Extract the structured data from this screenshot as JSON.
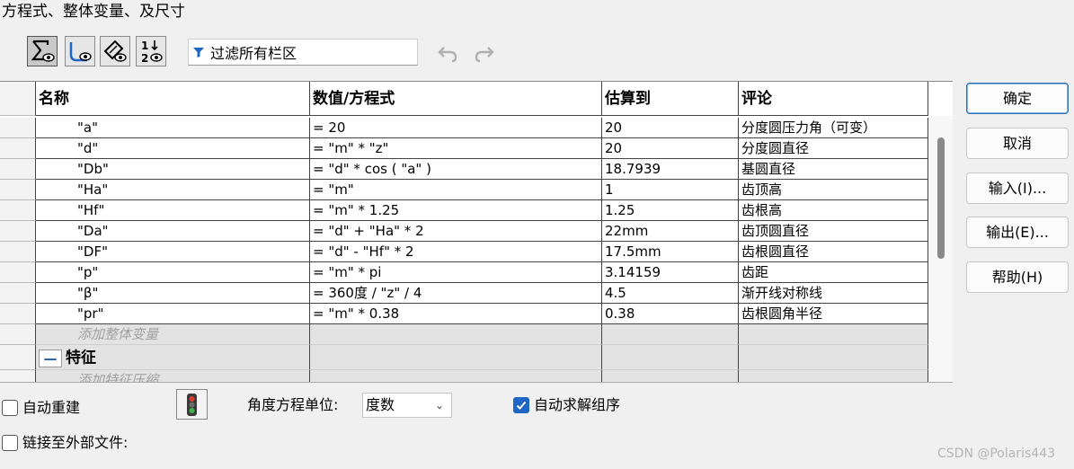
{
  "window": {
    "title": "方程式、整体变量、及尺寸"
  },
  "toolbar": {
    "buttons": [
      {
        "icon": "sigma-eye-icon",
        "active": true
      },
      {
        "icon": "sketch-eye-icon",
        "active": false
      },
      {
        "icon": "dimension-eye-icon",
        "active": false
      },
      {
        "icon": "order-eye-icon",
        "active": false
      }
    ],
    "filter": {
      "icon": "filter-icon",
      "placeholder": "过滤所有栏区"
    },
    "undo_icon": "undo-icon",
    "redo_icon": "redo-icon"
  },
  "table": {
    "headers": [
      "名称",
      "数值/方程式",
      "估算到",
      "评论"
    ],
    "rows": [
      {
        "name": "\"a\"",
        "value": "= 20",
        "eval": "20",
        "comment": "分度圆压力角（可变）"
      },
      {
        "name": "\"d\"",
        "value": "= \"m\" * \"z\"",
        "eval": "20",
        "comment": "分度圆直径"
      },
      {
        "name": "\"Db\"",
        "value": "= \"d\" * cos ( \"a\" )",
        "eval": "18.7939",
        "comment": "基圆直径"
      },
      {
        "name": "\"Ha\"",
        "value": "= \"m\"",
        "eval": "1",
        "comment": "齿顶高"
      },
      {
        "name": "\"Hf\"",
        "value": "= \"m\" * 1.25",
        "eval": "1.25",
        "comment": "齿根高"
      },
      {
        "name": "\"Da\"",
        "value": "= \"d\" + \"Ha\" * 2",
        "eval": "22mm",
        "comment": "齿顶圆直径"
      },
      {
        "name": "\"DF\"",
        "value": "= \"d\" - \"Hf\" * 2",
        "eval": "17.5mm",
        "comment": "齿根圆直径"
      },
      {
        "name": "\"p\"",
        "value": "= \"m\" * pi",
        "eval": "3.14159",
        "comment": "齿距"
      },
      {
        "name": "\"β\"",
        "value": "= 360度 / \"z\" / 4",
        "eval": "4.5",
        "comment": "渐开线对称线"
      },
      {
        "name": "\"pr\"",
        "value": "= \"m\" * 0.38",
        "eval": "0.38",
        "comment": "齿根圆角半径"
      }
    ],
    "add_global_placeholder": "添加整体变量",
    "section_features": {
      "collapse_symbol": "—",
      "label": "特征"
    },
    "add_feature_placeholder": "添加特征压缩"
  },
  "side_buttons": {
    "ok": "确定",
    "cancel": "取消",
    "import": "输入(I)...",
    "export": "输出(E)...",
    "help": "帮助(H)"
  },
  "bottom": {
    "auto_rebuild": {
      "label": "自动重建",
      "checked": false
    },
    "traffic_light_icon": "traffic-light-icon",
    "angle_unit": {
      "label": "角度方程单位:",
      "value": "度数"
    },
    "auto_solve_order": {
      "label": "自动求解组序",
      "checked": true
    },
    "link_external": {
      "label": "链接至外部文件:",
      "checked": false
    }
  },
  "watermark": "CSDN @Polaris443",
  "colors": {
    "accent": "#1d66c5",
    "grid_line": "#444444"
  }
}
